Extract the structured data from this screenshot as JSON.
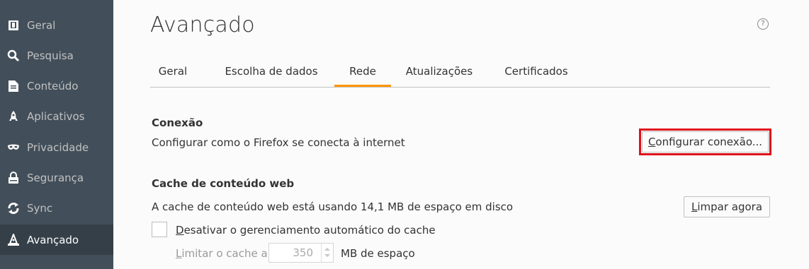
{
  "sidebar": {
    "items": [
      {
        "label": "Geral",
        "icon": "general-icon"
      },
      {
        "label": "Pesquisa",
        "icon": "search-icon"
      },
      {
        "label": "Conteúdo",
        "icon": "document-icon"
      },
      {
        "label": "Aplicativos",
        "icon": "rocket-icon"
      },
      {
        "label": "Privacidade",
        "icon": "mask-icon"
      },
      {
        "label": "Segurança",
        "icon": "lock-icon"
      },
      {
        "label": "Sync",
        "icon": "sync-icon"
      },
      {
        "label": "Avançado",
        "icon": "wizard-hat-icon",
        "selected": true
      }
    ]
  },
  "header": {
    "title": "Avançado",
    "help_glyph": "?"
  },
  "tabs": [
    "Geral",
    "Escolha de dados",
    "Rede",
    "Atualizações",
    "Certificados"
  ],
  "active_tab": "Rede",
  "connection": {
    "heading": "Conexão",
    "description": "Configurar como o Firefox se conecta à internet",
    "button_access_key": "C",
    "button_rest": "onfigurar conexão..."
  },
  "cache": {
    "heading": "Cache de conteúdo web",
    "description": "A cache de conteúdo web está usando 14,1 MB de espaço em disco",
    "clear_button_access_key": "L",
    "clear_button_rest": "impar agora",
    "disable_access_key": "D",
    "disable_rest": "esativar o gerenciamento automático do cache",
    "limit_access_key": "L",
    "limit_rest": "imitar o cache a",
    "limit_value": "350",
    "limit_unit": "MB de espaço"
  },
  "colors": {
    "sidebar_bg": "#424f5a",
    "tab_accent": "#ff9500",
    "highlight": "#e0101b"
  }
}
